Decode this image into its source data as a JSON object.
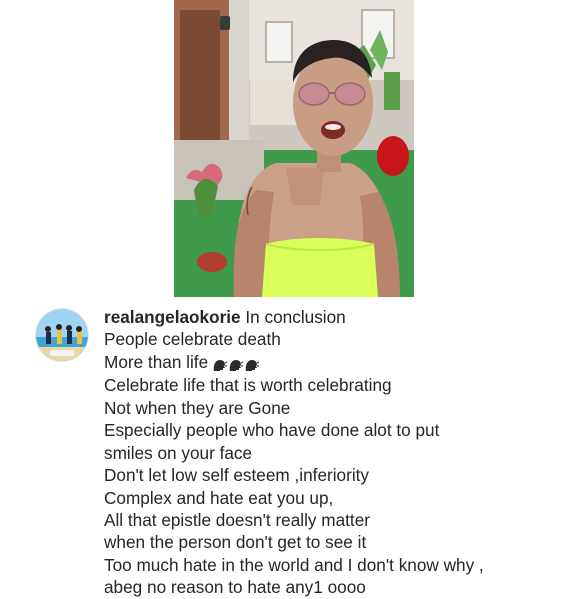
{
  "post": {
    "username": "realangelaokorie",
    "caption_lines": [
      "In conclusion",
      "People celebrate death",
      "More than life",
      "Celebrate life that is worth celebrating",
      "Not when they are Gone",
      "Especially people who have done alot to put",
      "smiles on your face",
      "Don't let low self esteem ,inferiority",
      "Complex and hate eat you up,",
      "All that epistle doesn't really matter",
      "when the person don't get to see it",
      "Too much hate in the world and I don't know why ,",
      "abeg no reason to hate any1 oooo"
    ],
    "emoji": "speaking-head-icon",
    "emoji_count": 3
  },
  "colors": {
    "text": "#262626",
    "top_color": "#d8ff5a"
  }
}
